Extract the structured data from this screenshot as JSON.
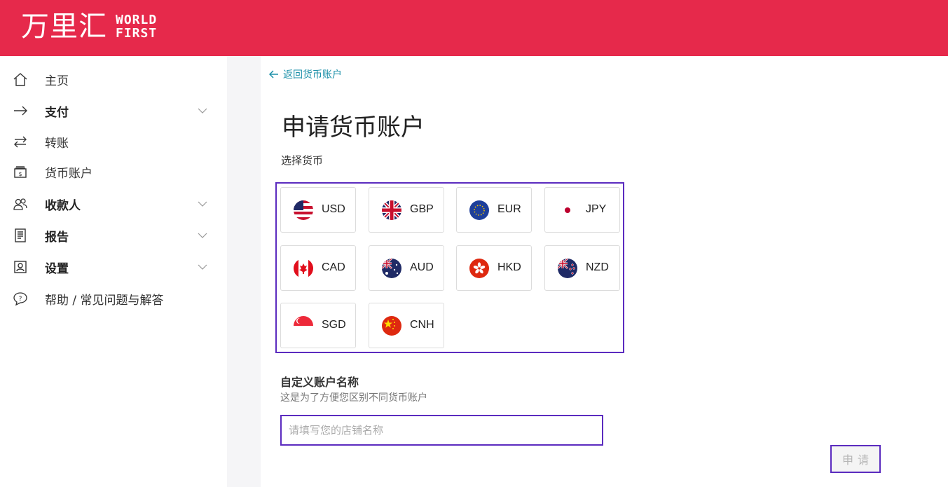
{
  "brand": {
    "cn": "万里汇",
    "en_line1": "WORLD",
    "en_line2": "FIRST",
    "color": "#e6294b"
  },
  "sidebar": {
    "items": [
      {
        "label": "主页",
        "icon": "home-icon",
        "bold": false,
        "expandable": false
      },
      {
        "label": "支付",
        "icon": "arrow-right-icon",
        "bold": true,
        "expandable": true
      },
      {
        "label": "转账",
        "icon": "transfer-icon",
        "bold": false,
        "expandable": false
      },
      {
        "label": "货币账户",
        "icon": "wallet-icon",
        "bold": false,
        "expandable": false
      },
      {
        "label": "收款人",
        "icon": "people-icon",
        "bold": true,
        "expandable": true
      },
      {
        "label": "报告",
        "icon": "report-icon",
        "bold": true,
        "expandable": true
      },
      {
        "label": "设置",
        "icon": "settings-icon",
        "bold": true,
        "expandable": true
      },
      {
        "label": "帮助 / 常见问题与解答",
        "icon": "help-icon",
        "bold": false,
        "expandable": false
      }
    ]
  },
  "main": {
    "back_label": "返回货币账户",
    "title": "申请货币账户",
    "select_currency_label": "选择货币",
    "currencies": [
      {
        "code": "USD",
        "flag": "us-flag-icon"
      },
      {
        "code": "GBP",
        "flag": "gb-flag-icon"
      },
      {
        "code": "EUR",
        "flag": "eu-flag-icon"
      },
      {
        "code": "JPY",
        "flag": "jp-flag-icon"
      },
      {
        "code": "CAD",
        "flag": "ca-flag-icon"
      },
      {
        "code": "AUD",
        "flag": "au-flag-icon"
      },
      {
        "code": "HKD",
        "flag": "hk-flag-icon"
      },
      {
        "code": "NZD",
        "flag": "nz-flag-icon"
      },
      {
        "code": "SGD",
        "flag": "sg-flag-icon"
      },
      {
        "code": "CNH",
        "flag": "cn-flag-icon"
      }
    ],
    "custom_name_label": "自定义账户名称",
    "custom_name_hint": "这是为了方便您区别不同货币账户",
    "custom_name_placeholder": "请填写您的店铺名称",
    "custom_name_value": "",
    "submit_label": "申请"
  },
  "colors": {
    "accent": "#5b2bbf",
    "link": "#1a8fa8",
    "brand_red": "#e6294b"
  }
}
